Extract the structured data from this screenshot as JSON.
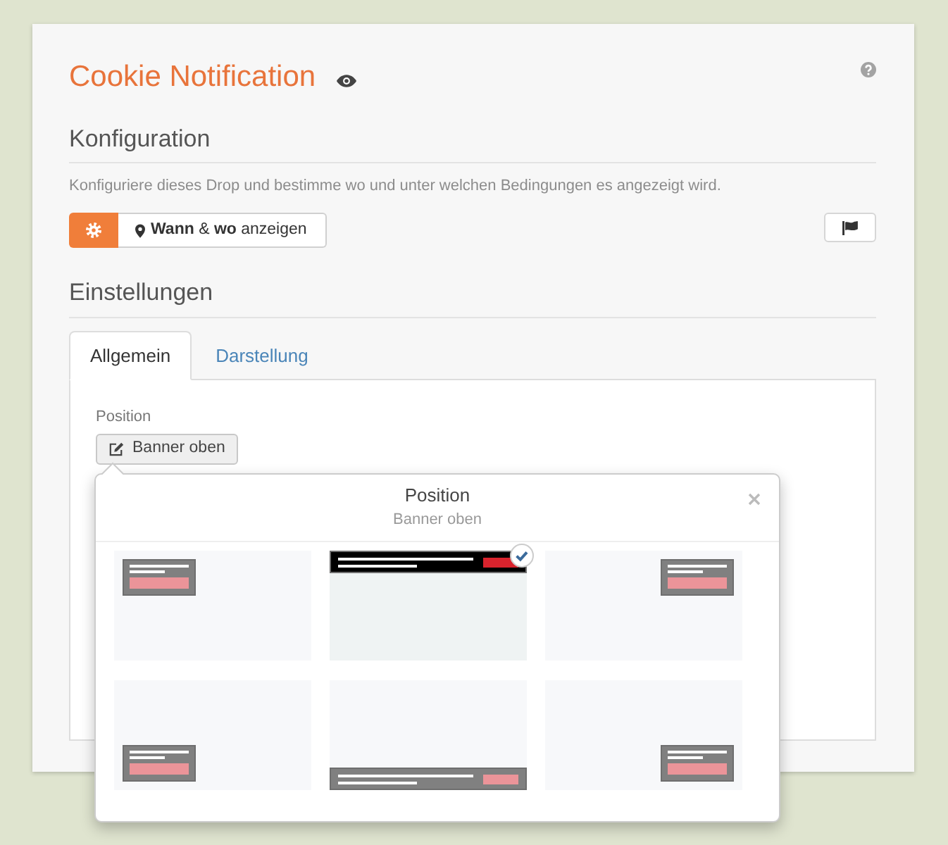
{
  "header": {
    "title": "Cookie Notification"
  },
  "configuration": {
    "heading": "Konfiguration",
    "description": "Konfiguriere dieses Drop und bestimme wo und unter welchen Bedingungen es angezeigt wird.",
    "display_button": "**Wann** & **wo** anzeigen"
  },
  "settings": {
    "heading": "Einstellungen",
    "tabs": [
      {
        "label": "Allgemein",
        "selected": true
      },
      {
        "label": "Darstellung",
        "selected": false
      }
    ],
    "position": {
      "label": "Position",
      "value": "Banner oben"
    }
  },
  "position_popover": {
    "title": "Position",
    "subtitle": "Banner oben",
    "options": [
      {
        "kind": "top-left",
        "selected": false
      },
      {
        "kind": "top-banner",
        "selected": true
      },
      {
        "kind": "top-right",
        "selected": false
      },
      {
        "kind": "bottom-left",
        "selected": false
      },
      {
        "kind": "bottom-banner",
        "selected": false
      },
      {
        "kind": "bottom-right",
        "selected": false
      }
    ]
  }
}
